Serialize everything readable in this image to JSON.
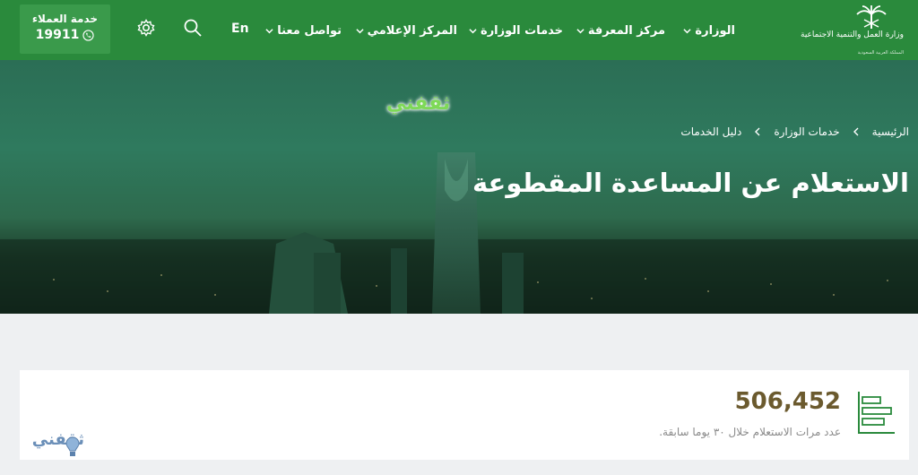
{
  "header": {
    "logo_text": "وزارة العمل والتنمية الاجتماعية",
    "logo_sub": "المملكة العربية السعودية",
    "nav": [
      {
        "label": "الوزارة"
      },
      {
        "label": "مركز المعرفة"
      },
      {
        "label": "خدمات الوزارة"
      },
      {
        "label": "المركز الإعلامي"
      },
      {
        "label": "تواصل معنا"
      }
    ],
    "lang": "En",
    "customer_service": {
      "label": "خدمة العملاء",
      "phone": "19911"
    }
  },
  "hero": {
    "watermark": "ثقفني",
    "breadcrumb": [
      "الرئيسية",
      "خدمات الوزارة",
      "دليل الخدمات"
    ],
    "title": "الاستعلام عن المساعدة المقطوعة"
  },
  "stats": {
    "count": "506,452",
    "label": "عدد مرات الاستعلام خلال ٣٠ يوما سابقة."
  },
  "corner_watermark": "ثقفني",
  "colors": {
    "nav_bg": "#2a8a3c",
    "accent_number": "#6b5a2e",
    "icon": "#2a8a3c"
  }
}
